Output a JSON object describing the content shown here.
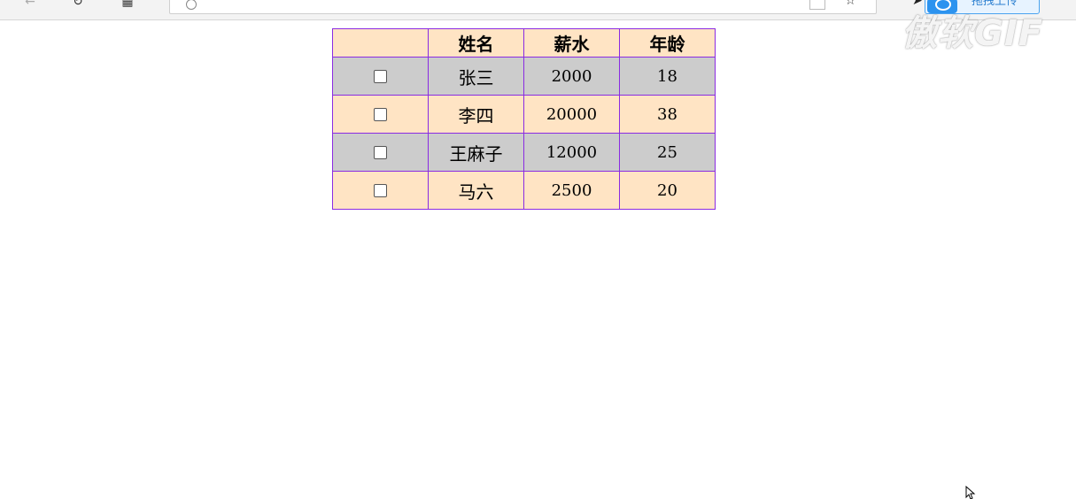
{
  "browser": {
    "drag_upload_label": "拖拽上传",
    "watermark": "傲软GIF"
  },
  "table": {
    "headers": [
      "",
      "姓名",
      "薪水",
      "年龄"
    ],
    "rows": [
      {
        "checked": false,
        "name": "张三",
        "salary": "2000",
        "age": "18"
      },
      {
        "checked": false,
        "name": "李四",
        "salary": "20000",
        "age": "38"
      },
      {
        "checked": false,
        "name": "王麻子",
        "salary": "12000",
        "age": "25"
      },
      {
        "checked": false,
        "name": "马六",
        "salary": "2500",
        "age": "20"
      }
    ],
    "colors": {
      "header_bg": "#ffe4c4",
      "odd_row_bg": "#cccccc",
      "even_row_bg": "#ffe4c4",
      "border": "#8a2be2"
    }
  }
}
